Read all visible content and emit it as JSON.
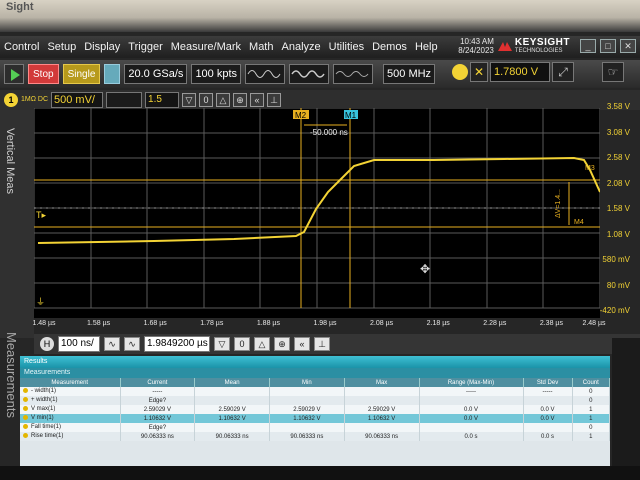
{
  "bezel": {
    "text": "Sight"
  },
  "menu": {
    "items": [
      "Control",
      "Setup",
      "Display",
      "Trigger",
      "Measure/Mark",
      "Math",
      "Analyze",
      "Utilities",
      "Demos",
      "Help"
    ],
    "time": "10:43 AM",
    "date": "8/24/2023",
    "brand": "KEYSIGHT",
    "brand_sub": "TECHNOLOGIES"
  },
  "toolbar": {
    "stop_label": "Stop",
    "single_label": "Single",
    "sample_rate": "20.0 GSa/s",
    "memory_depth": "100 kpts",
    "bandwidth": "500 MHz",
    "trigger_level": "1.7800 V"
  },
  "channel": {
    "number": "1",
    "coupling": "1MΩ DC",
    "scale": "500 mV/",
    "offset": "1.5"
  },
  "left_strip": {
    "vertical_label": "Vertical Meas",
    "measurements_label": "Measurements"
  },
  "graticule": {
    "y_ticks": [
      "3.58 V",
      "3.08 V",
      "2.58 V",
      "2.08 V",
      "1.58 V",
      "1.08 V",
      "580 mV",
      "80 mV",
      "-420 mV"
    ],
    "x_ticks": [
      "1.48 µs",
      "1.58 µs",
      "1.68 µs",
      "1.78 µs",
      "1.88 µs",
      "1.98 µs",
      "2.08 µs",
      "2.18 µs",
      "2.28 µs",
      "2.38 µs",
      "2.48 µs"
    ],
    "marker_m1": "M1",
    "marker_m2": "M2",
    "marker_m3": "M3",
    "marker_m4": "M4",
    "delta_t": "-50.000 ns",
    "delta_v": "ΔV=1.4..."
  },
  "timebase": {
    "scale": "100 ns/",
    "delay": "1.9849200 µs"
  },
  "results": {
    "title": "Results",
    "subtitle": "Measurements",
    "columns": [
      "Measurement",
      "Current",
      "Mean",
      "Min",
      "Max",
      "Range (Max-Min)",
      "Std Dev",
      "Count"
    ],
    "rows": [
      {
        "name": "- width(1)",
        "current": "-----",
        "mean": "",
        "min": "",
        "max": "",
        "range": "-----",
        "std": "-----",
        "count": "0"
      },
      {
        "name": "+ width(1)",
        "current": "Edge?",
        "mean": "",
        "min": "",
        "max": "",
        "range": "",
        "std": "",
        "count": "0"
      },
      {
        "name": "V max(1)",
        "current": "2.59029 V",
        "mean": "2.59029 V",
        "min": "2.59029 V",
        "max": "2.59029 V",
        "range": "0.0 V",
        "std": "0.0 V",
        "count": "1"
      },
      {
        "name": "V min(1)",
        "current": "1.10632 V",
        "mean": "1.10632 V",
        "min": "1.10632 V",
        "max": "1.10632 V",
        "range": "0.0 V",
        "std": "0.0 V",
        "count": "1"
      },
      {
        "name": "Fall time(1)",
        "current": "Edge?",
        "mean": "",
        "min": "",
        "max": "",
        "range": "",
        "std": "",
        "count": "0"
      },
      {
        "name": "Rise time(1)",
        "current": "90.06333 ns",
        "mean": "90.06333 ns",
        "min": "90.06333 ns",
        "max": "90.06333 ns",
        "range": "0.0 s",
        "std": "0.0 s",
        "count": "1"
      }
    ]
  },
  "colors": {
    "trace": "#f3d335",
    "accent": "#22a6bd",
    "stop": "#d23a3a"
  }
}
